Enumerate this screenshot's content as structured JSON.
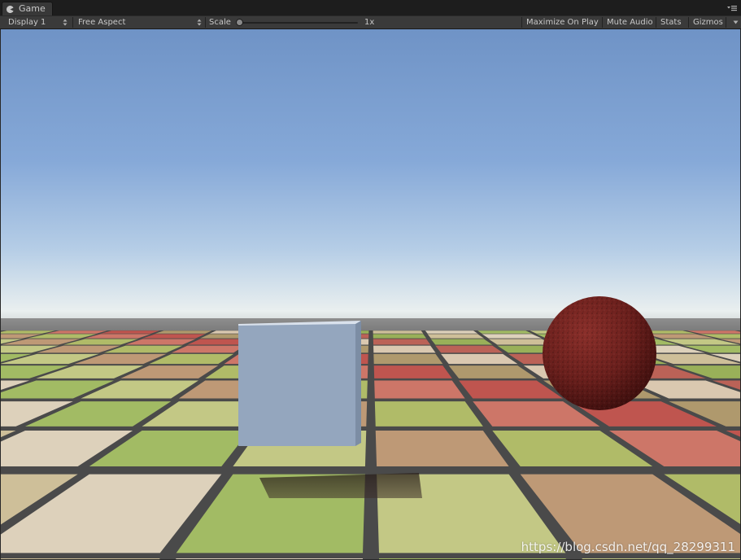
{
  "window": {
    "tab_label": "Game",
    "tab_icon": "pacman-game-icon"
  },
  "toolbar": {
    "display": "Display 1",
    "aspect": "Free Aspect",
    "scale_label": "Scale",
    "scale_value": "1x",
    "scale_slider_level": 0,
    "maximize_on_play": "Maximize On Play",
    "mute_audio": "Mute Audio",
    "stats": "Stats",
    "gizmos": "Gizmos"
  },
  "scene": {
    "sky_top_color": "#6f93c6",
    "sky_horizon_color": "#e9efef",
    "ground_color": "#4a4a4a",
    "cube_color": "#94a6be",
    "sphere_color": "#6a1f1c"
  },
  "watermark": "https://blog.csdn.net/qq_28299311"
}
